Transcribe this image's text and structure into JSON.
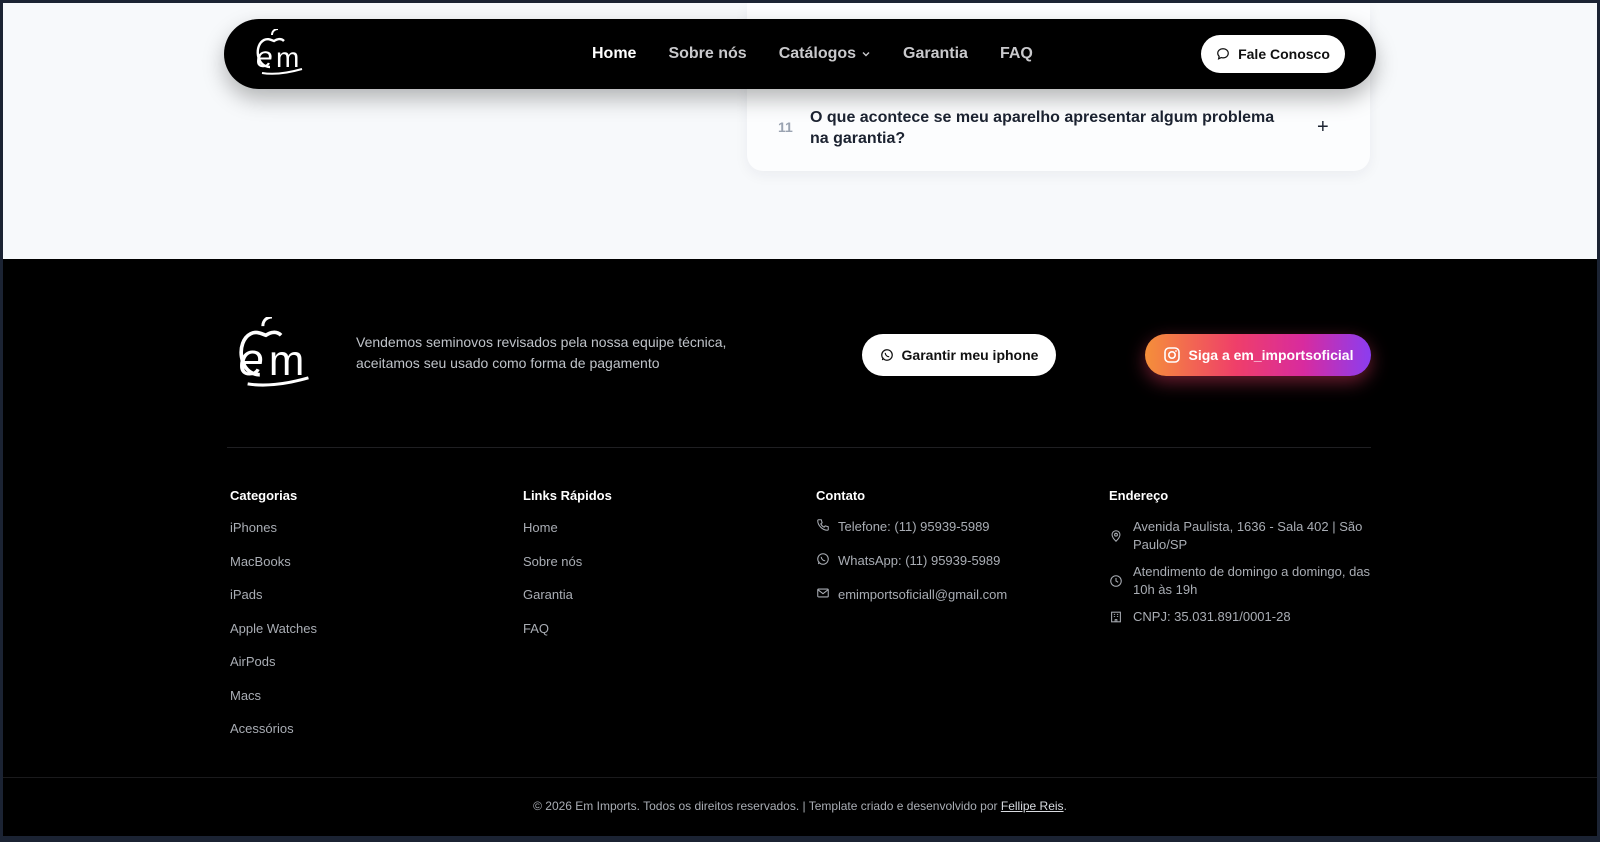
{
  "nav": {
    "links": [
      {
        "label": "Home"
      },
      {
        "label": "Sobre nós"
      },
      {
        "label": "Catálogos"
      },
      {
        "label": "Garantia"
      },
      {
        "label": "FAQ"
      }
    ],
    "contact_button": "Fale Conosco"
  },
  "faq": {
    "number": "11",
    "question": "O que acontece se meu aparelho apresentar algum problema na garantia?",
    "toggle": "+"
  },
  "footer": {
    "tagline": "Vendemos seminovos revisados pela nossa equipe técnica, aceitamos seu usado como forma de pagamento",
    "cta_iphone": "Garantir meu iphone",
    "cta_instagram": "Siga a em_importsoficial",
    "categories": {
      "title": "Categorias",
      "items": [
        "iPhones",
        "MacBooks",
        "iPads",
        "Apple Watches",
        "AirPods",
        "Macs",
        "Acessórios"
      ]
    },
    "quick_links": {
      "title": "Links Rápidos",
      "items": [
        "Home",
        "Sobre nós",
        "Garantia",
        "FAQ"
      ]
    },
    "contact": {
      "title": "Contato",
      "phone": "Telefone: (11) 95939-5989",
      "whatsapp": "WhatsApp: (11) 95939-5989",
      "email": "emimportsoficiall@gmail.com"
    },
    "address": {
      "title": "Endereço",
      "street": "Avenida Paulista, 1636 - Sala 402 | São Paulo/SP",
      "hours": "Atendimento de domingo a domingo, das 10h às 19h",
      "cnpj": "CNPJ: 35.031.891/0001-28"
    },
    "copyright": "© 2026 Em Imports. Todos os direitos reservados. | Template criado e desenvolvido por",
    "author": "Fellipe Reis",
    "end": "."
  }
}
